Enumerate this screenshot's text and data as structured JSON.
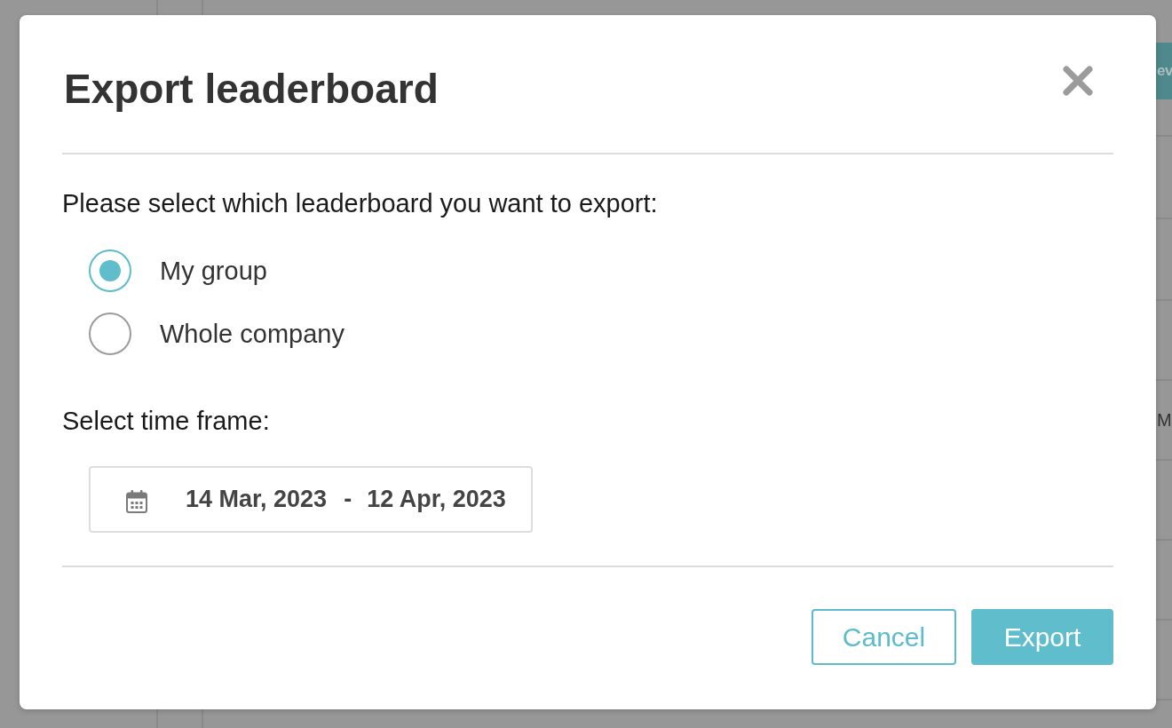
{
  "background": {
    "button_text": "ev",
    "cell_text": "M"
  },
  "dialog": {
    "title": "Export leaderboard",
    "prompt": "Please select which leaderboard you want to export:",
    "options": [
      {
        "label": "My group",
        "selected": true
      },
      {
        "label": "Whole company",
        "selected": false
      }
    ],
    "time_frame": {
      "label": "Select time frame:",
      "start": "14 Mar, 2023",
      "separator": "-",
      "end": "12 Apr, 2023"
    },
    "buttons": [
      {
        "label": "Cancel",
        "kind": "cancel"
      },
      {
        "label": "Export",
        "kind": "confirm"
      }
    ]
  }
}
